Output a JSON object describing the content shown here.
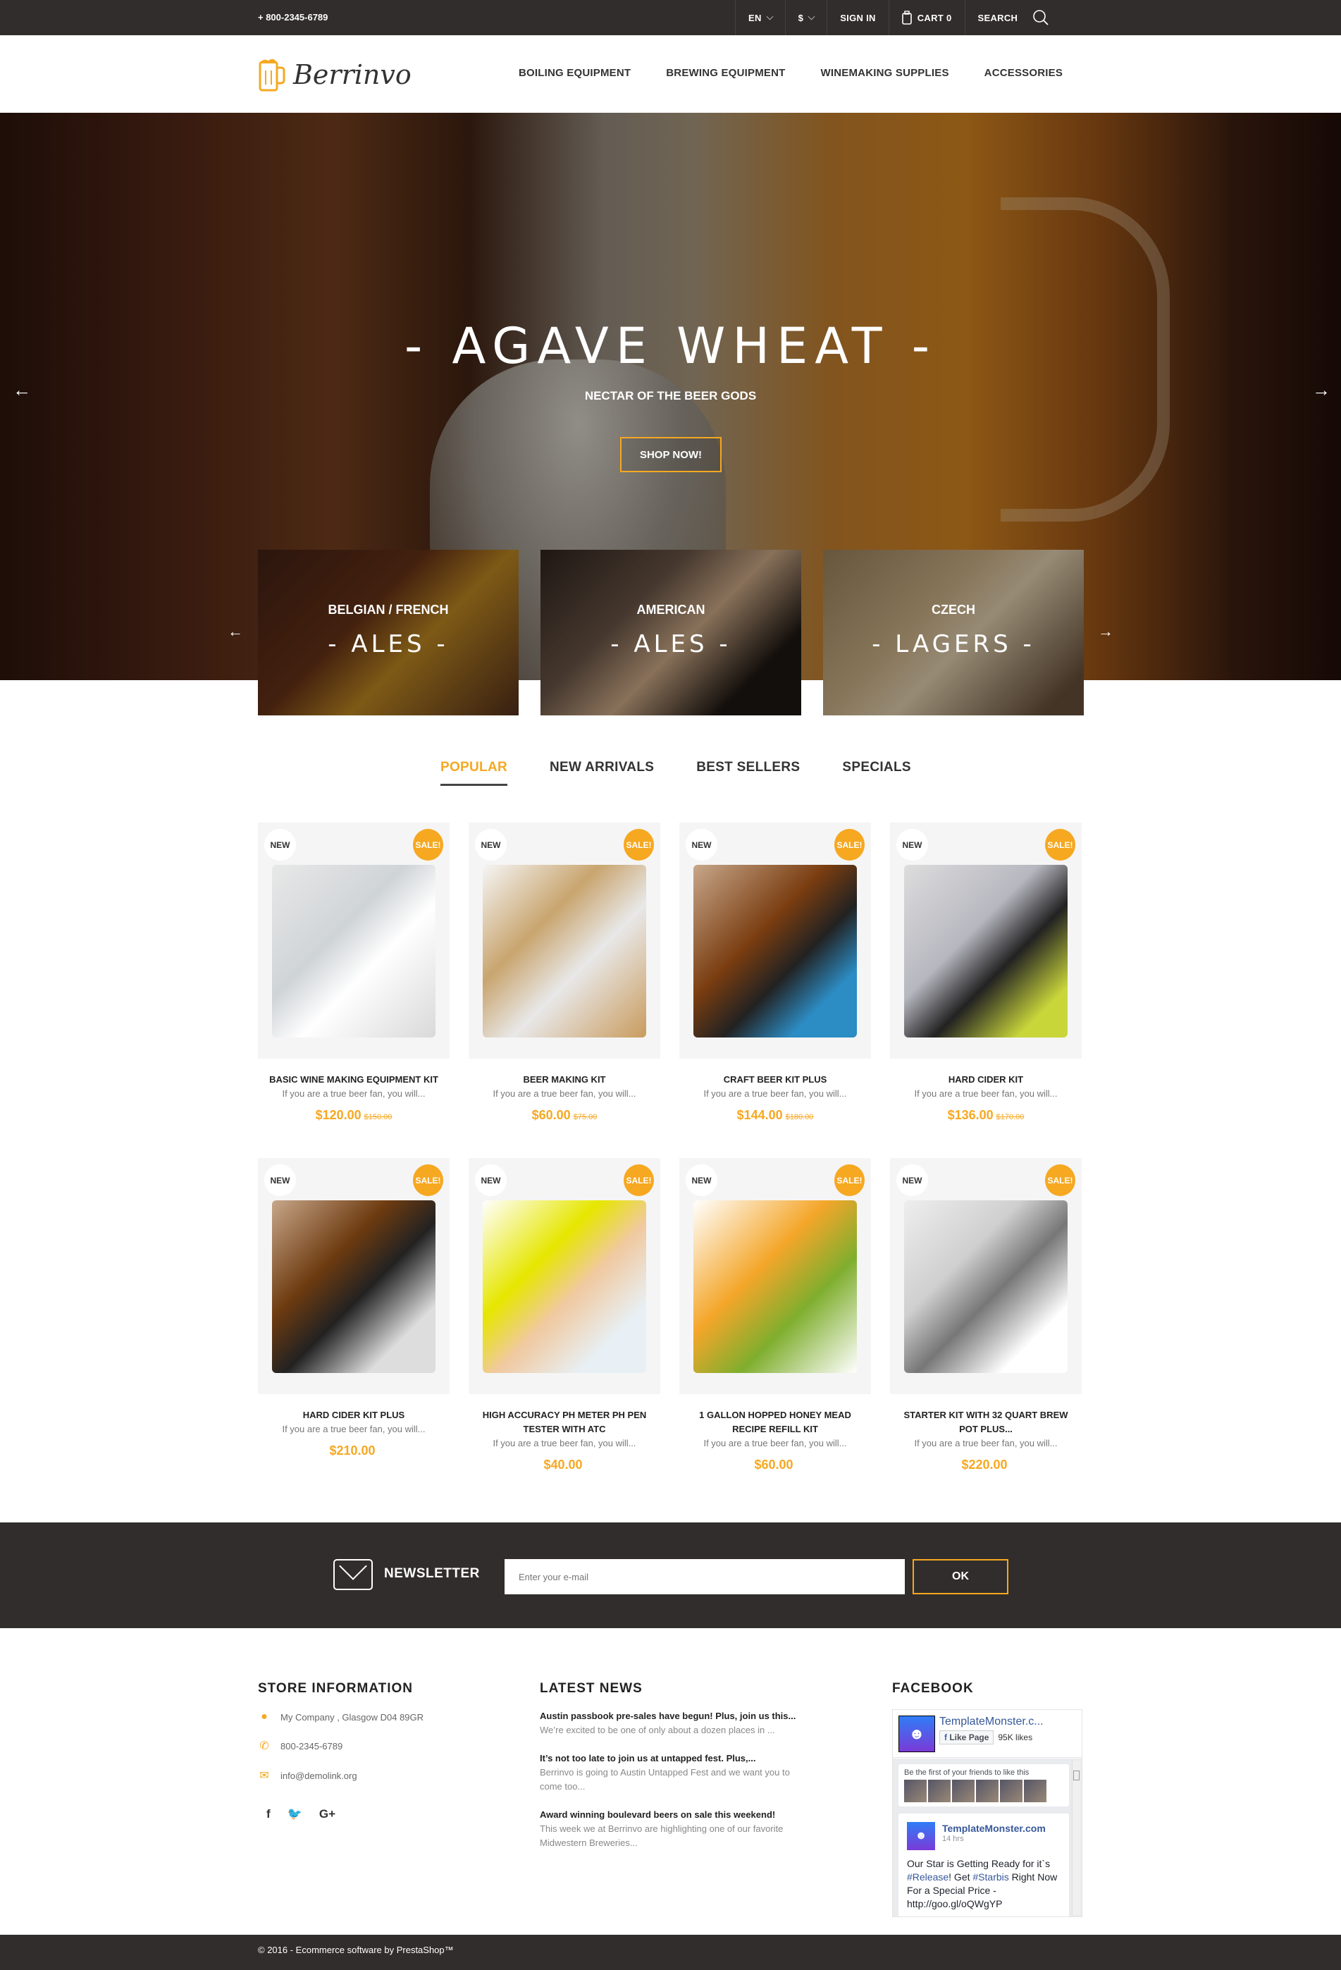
{
  "topbar": {
    "phone": "+ 800-2345-6789",
    "language": "EN",
    "currency": "$",
    "sign_in": "SIGN IN",
    "cart_label": "CART",
    "cart_count": "0",
    "search": "SEARCH"
  },
  "header": {
    "logo_text": "Berrinvo",
    "nav": [
      "BOILING EQUIPMENT",
      "BREWING EQUIPMENT",
      "WINEMAKING SUPPLIES",
      "ACCESSORIES"
    ]
  },
  "hero": {
    "title": "- AGAVE WHEAT -",
    "subtitle": "NECTAR OF THE BEER GODS",
    "button": "SHOP NOW!"
  },
  "categories": [
    {
      "label": "BELGIAN / FRENCH",
      "type": "- ALES -"
    },
    {
      "label": "AMERICAN",
      "type": "- ALES -"
    },
    {
      "label": "CZECH",
      "type": "- LAGERS -"
    }
  ],
  "tabs": [
    {
      "label": "POPULAR",
      "active": true
    },
    {
      "label": "NEW ARRIVALS",
      "active": false
    },
    {
      "label": "BEST SELLERS",
      "active": false
    },
    {
      "label": "SPECIALS",
      "active": false
    }
  ],
  "badges": {
    "new": "NEW",
    "sale": "SALE!"
  },
  "products": [
    {
      "title": "BASIC WINE MAKING EQUIPMENT KIT",
      "desc": "If you are a true beer fan, you will...",
      "price": "$120.00",
      "old_price": "$150.00",
      "sale": true
    },
    {
      "title": "BEER MAKING KIT",
      "desc": "If you are a true beer fan, you will...",
      "price": "$60.00",
      "old_price": "$75.00",
      "sale": true
    },
    {
      "title": "CRAFT BEER KIT PLUS",
      "desc": "If you are a true beer fan, you will...",
      "price": "$144.00",
      "old_price": "$180.00",
      "sale": true
    },
    {
      "title": "HARD CIDER KIT",
      "desc": "If you are a true beer fan, you will...",
      "price": "$136.00",
      "old_price": "$170.00",
      "sale": true
    },
    {
      "title": "HARD CIDER KIT PLUS",
      "desc": "If you are a true beer fan, you will...",
      "price": "$210.00",
      "old_price": "",
      "sale": true
    },
    {
      "title": "HIGH ACCURACY PH METER PH PEN TESTER WITH ATC",
      "desc": "If you are a true beer fan, you will...",
      "price": "$40.00",
      "old_price": "",
      "sale": true
    },
    {
      "title": "1 GALLON HOPPED HONEY MEAD RECIPE REFILL KIT",
      "desc": "If you are a true beer fan, you will...",
      "price": "$60.00",
      "old_price": "",
      "sale": true
    },
    {
      "title": "STARTER KIT WITH 32 QUART BREW POT PLUS...",
      "desc": "If you are a true beer fan, you will...",
      "price": "$220.00",
      "old_price": "",
      "sale": true
    }
  ],
  "newsletter": {
    "label": "NEWSLETTER",
    "placeholder": "Enter your e-mail",
    "button": "OK"
  },
  "footer": {
    "store": {
      "heading": "STORE INFORMATION",
      "address": "My Company , Glasgow D04 89GR",
      "phone": "800-2345-6789",
      "email": "info@demolink.org",
      "social": [
        "f",
        "t",
        "G+"
      ]
    },
    "news": {
      "heading": "LATEST NEWS",
      "items": [
        {
          "title": "Austin passbook pre-sales have begun! Plus, join us this...",
          "desc": "We’re excited to be one of only about a dozen places in ..."
        },
        {
          "title": "It’s not too late to join us at untapped fest. Plus,...",
          "desc": "Berrinvo is going to Austin Untapped Fest and we want you to come too..."
        },
        {
          "title": "Award winning boulevard beers on sale this weekend!",
          "desc": "This week we at Berrinvo are highlighting one of our favorite Midwestern Breweries..."
        }
      ]
    },
    "facebook": {
      "heading": "FACEBOOK",
      "page_name": "TemplateMonster.c...",
      "like_button": "Like Page",
      "likes": "95K likes",
      "friends_text": "Be the first of your friends to like this",
      "post_author": "TemplateMonster.com",
      "post_time": "14 hrs",
      "post_text_1": "Our Star is Getting Ready for it`s ",
      "post_tag_1": "#Release",
      "post_text_2": "! Get ",
      "post_tag_2": "#Starbis",
      "post_text_3": " Right Now For a Special Price - http://goo.gl/oQWgYP"
    },
    "copyright": "© 2016 - Ecommerce software by PrestaShop™"
  },
  "colors": {
    "accent": "#f6a821",
    "dark": "#312d2c"
  }
}
